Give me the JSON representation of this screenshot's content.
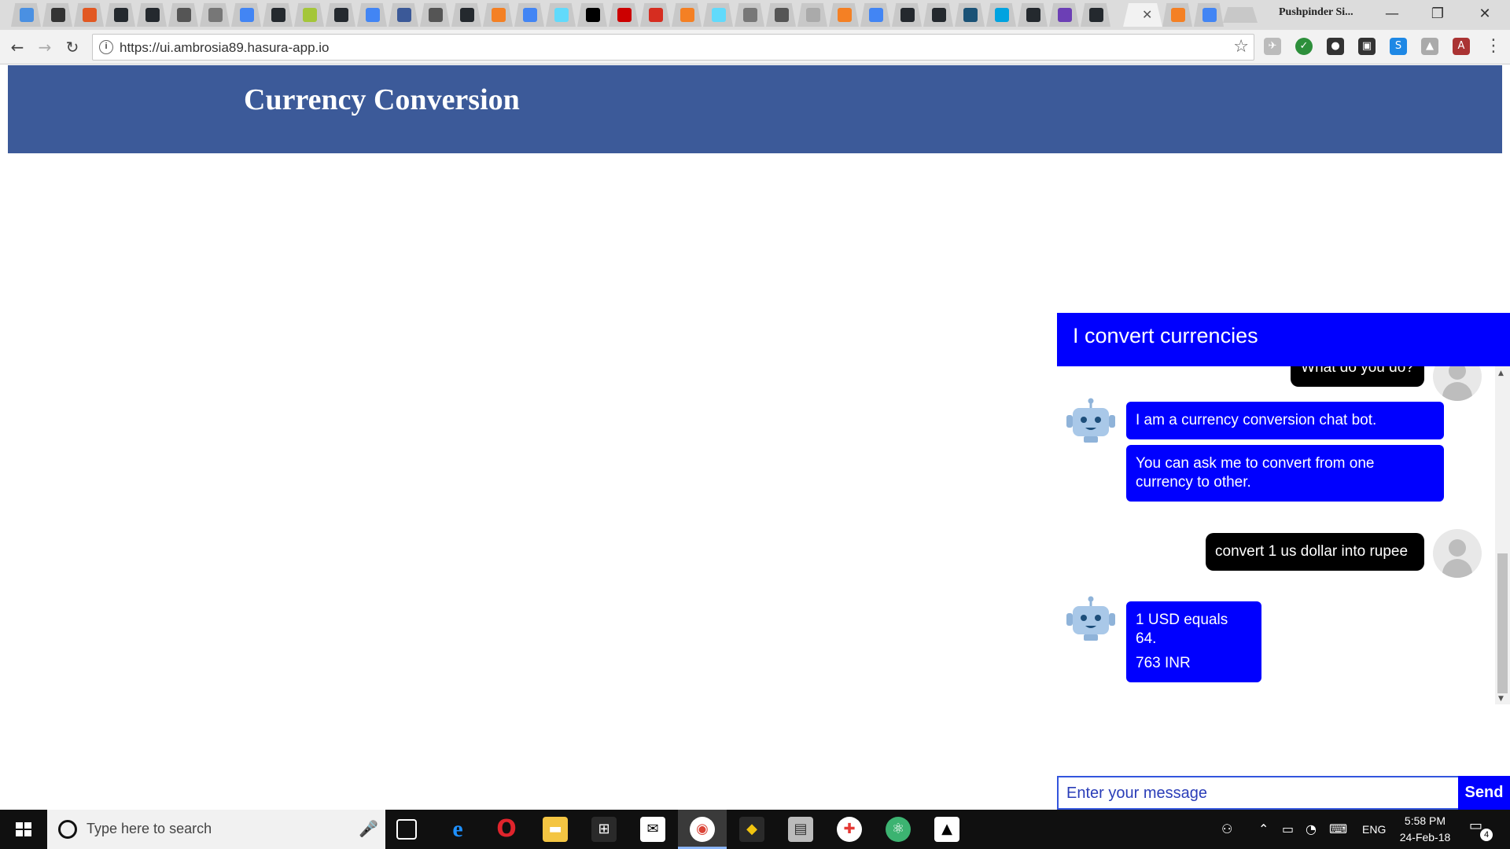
{
  "browser": {
    "profile_name": "Pushpinder Si...",
    "address": "https://ui.ambrosia89.hasura-app.io",
    "tab_close_glyph": "✕",
    "colors": {
      "chrome": "#dcdcdc",
      "toolbar": "#f2f2f2"
    }
  },
  "page": {
    "banner_title": "Currency Conversion",
    "banner_color": "#3c5a99"
  },
  "chat": {
    "header_title": "I convert currencies",
    "accent_color": "#0000ff",
    "messages": [
      {
        "sender": "user",
        "text": "What do you do?"
      },
      {
        "sender": "bot",
        "text": "I am a currency conversion chat bot."
      },
      {
        "sender": "bot",
        "text": "You can ask me to convert from one currency to other."
      },
      {
        "sender": "user",
        "text": "convert 1 us dollar into rupee"
      },
      {
        "sender": "bot",
        "text": "1 USD equals 64."
      },
      {
        "sender": "bot",
        "text": "763 INR"
      }
    ],
    "input_placeholder": "Enter your message",
    "send_label": "Send"
  },
  "taskbar": {
    "search_placeholder": "Type here to search",
    "language": "ENG",
    "time": "5:58 PM",
    "date": "24-Feb-18",
    "notification_count": "4"
  }
}
